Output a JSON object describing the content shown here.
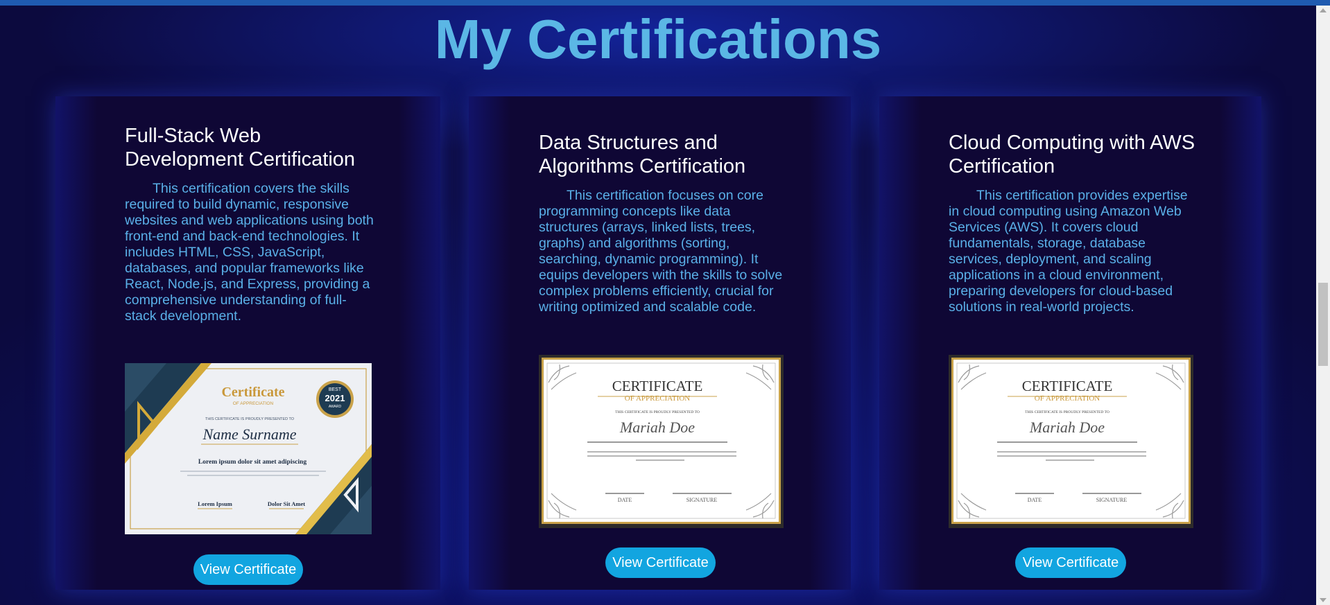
{
  "page": {
    "title": "My Certifications"
  },
  "colors": {
    "accent": "#5bb7e5",
    "button": "#12a5e0",
    "background": "#0c0a3e",
    "card": "#0f0735"
  },
  "cards": [
    {
      "title": "Full-Stack Web Development Certification",
      "description": "This certification covers the skills required to build dynamic, responsive websites and web applications using both front-end and back-end technologies. It includes HTML, CSS, JavaScript, databases, and popular frameworks like React, Node.js, and Express, providing a comprehensive understanding of full-stack development.",
      "button": "View Certificate",
      "image": {
        "heading": "Certificate",
        "subheading": "OF APPRECIATION",
        "presented": "THIS CERTIFICATE IS PROUDLY PRESENTED TO",
        "name": "Name Surname",
        "tagline": "Lorem ipsum dolor sit amet adipiscing",
        "badge_top": "BEST",
        "badge_year": "2021",
        "badge_bottom": "AWARD",
        "sign_left": "Lorem Ipsum",
        "sign_right": "Dolor Sit Amet"
      }
    },
    {
      "title": "Data Structures and Algorithms Certification",
      "description": "This certification focuses on core programming concepts like data structures (arrays, linked lists, trees, graphs) and algorithms (sorting, searching, dynamic programming). It equips developers with the skills to solve complex problems efficiently, crucial for writing optimized and scalable code.",
      "button": "View Certificate",
      "image": {
        "heading": "CERTIFICATE",
        "subheading": "OF APPRECIATION",
        "presented": "THIS CERTIFICATE IS PROUDLY PRESENTED TO",
        "name": "Mariah Doe",
        "sign_left": "DATE",
        "sign_right": "SIGNATURE"
      }
    },
    {
      "title": "Cloud Computing with AWS Certification",
      "description": "This certification provides expertise in cloud computing using Amazon Web Services (AWS). It covers cloud fundamentals, storage, database services, deployment, and scaling applications in a cloud environment, preparing developers for cloud-based solutions in real-world projects.",
      "button": "View Certificate",
      "image": {
        "heading": "CERTIFICATE",
        "subheading": "OF APPRECIATION",
        "presented": "THIS CERTIFICATE IS PROUDLY PRESENTED TO",
        "name": "Mariah Doe",
        "sign_left": "DATE",
        "sign_right": "SIGNATURE"
      }
    }
  ]
}
